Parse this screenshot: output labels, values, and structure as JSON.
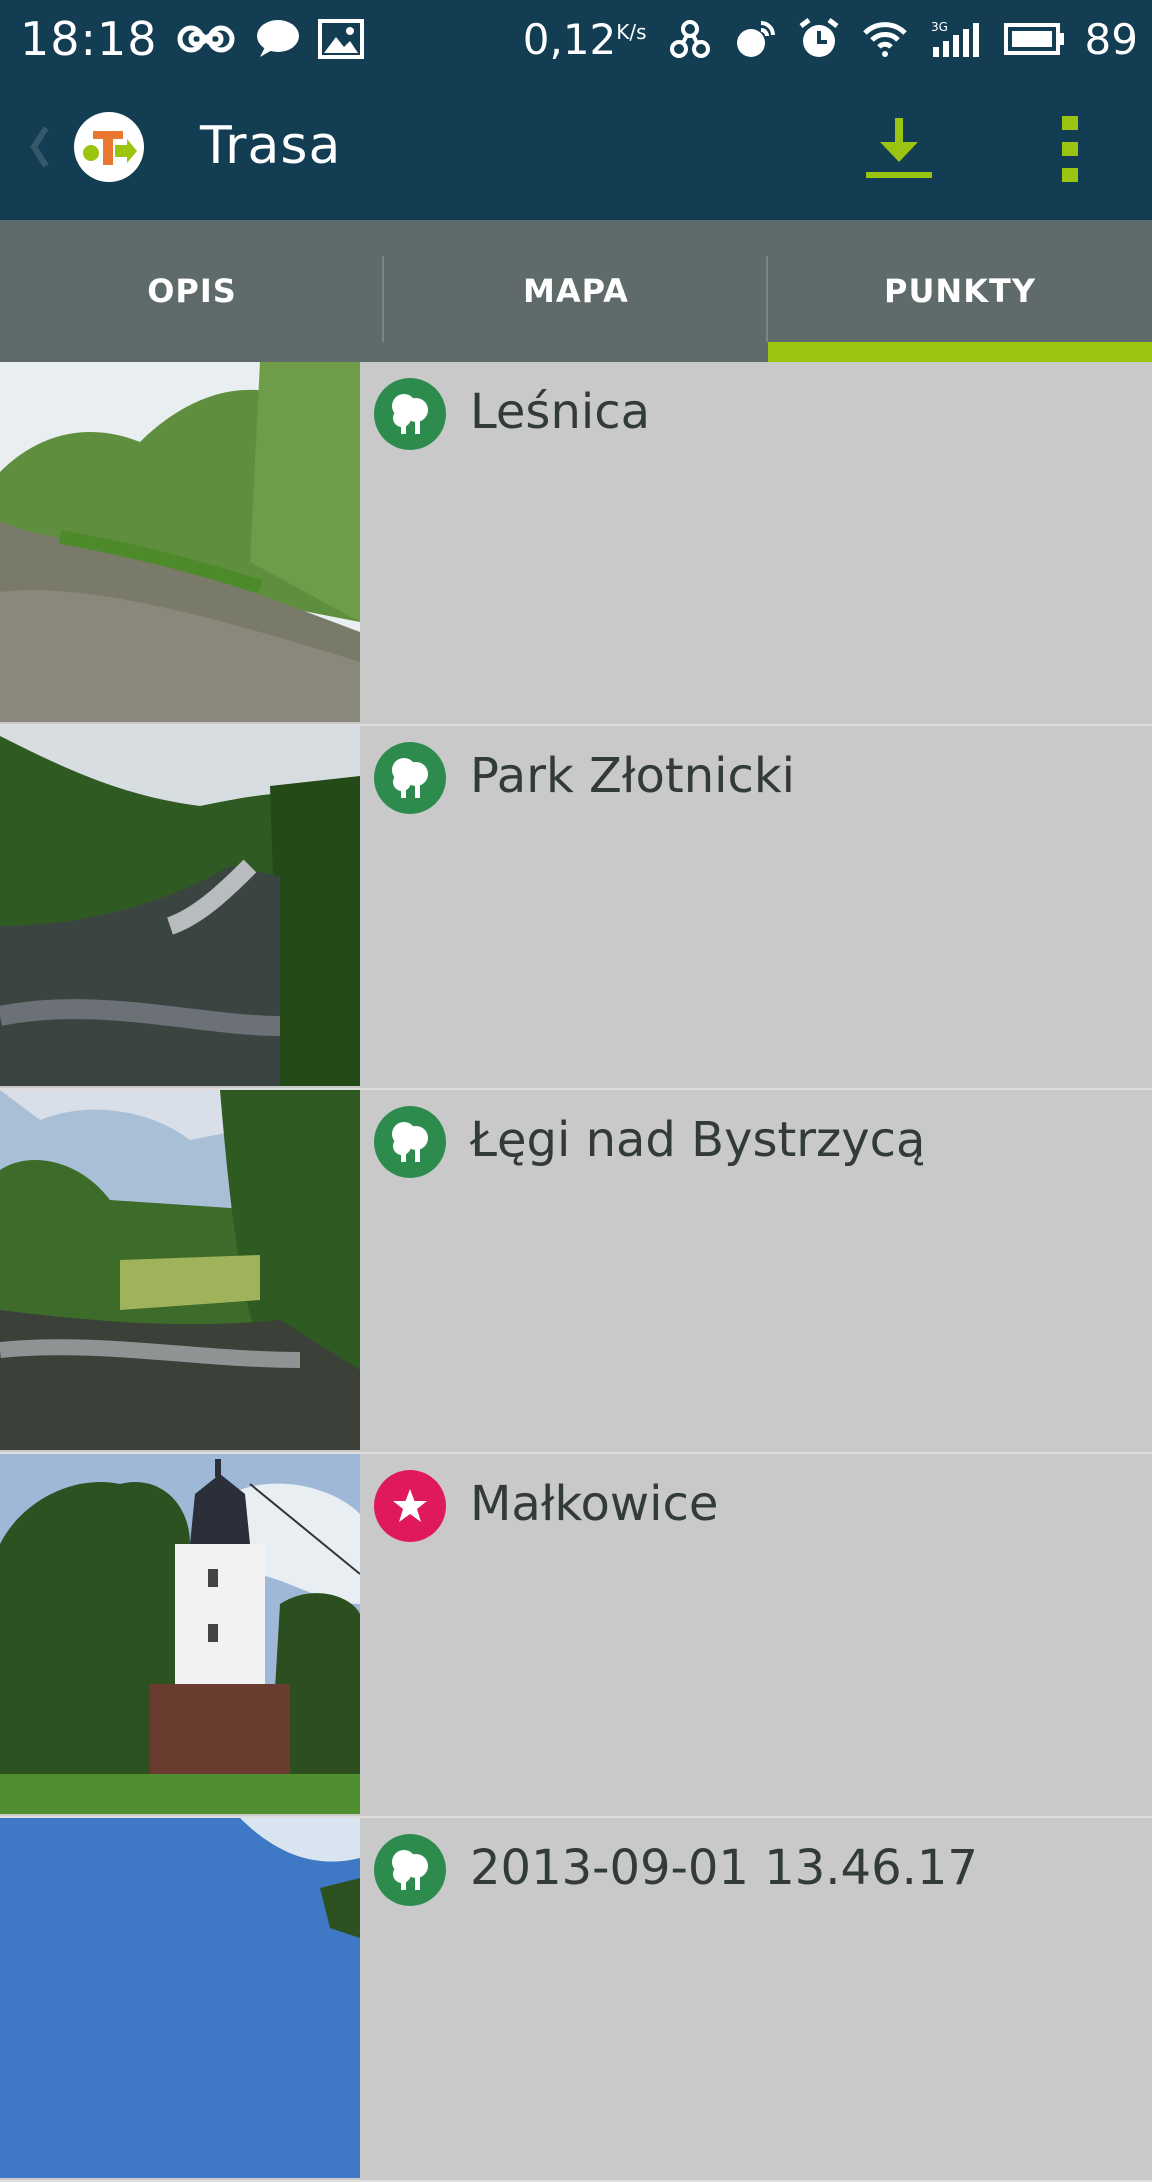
{
  "status_bar": {
    "time": "18:18",
    "net_speed": "0,12",
    "net_speed_unit": "K/s",
    "battery": "89",
    "icons": [
      "infinity-icon",
      "chat-icon",
      "image-icon",
      "network-icon",
      "gps-icon",
      "alarm-icon",
      "wifi-icon",
      "signal-3g-icon",
      "battery-icon"
    ]
  },
  "app_bar": {
    "title": "Trasa",
    "actions": [
      "download-icon",
      "overflow-menu-icon"
    ]
  },
  "tabs": [
    {
      "label": "OPIS"
    },
    {
      "label": "MAPA"
    },
    {
      "label": "PUNKTY"
    }
  ],
  "active_tab": "PUNKTY",
  "colors": {
    "status_bar_bg": "#133d52",
    "tab_bar_bg": "#5f6a6a",
    "accent": "#9bc410",
    "nature_icon": "#2e8b4e",
    "monument_icon": "#e0195c",
    "list_bg": "#c9c9c9"
  },
  "points": [
    {
      "name": "Leśnica",
      "category_icon": "tree-icon"
    },
    {
      "name": "Park Złotnicki",
      "category_icon": "tree-icon"
    },
    {
      "name": "Łęgi nad Bystrzycą",
      "category_icon": "tree-icon"
    },
    {
      "name": "Małkowice",
      "category_icon": "star-icon"
    },
    {
      "name": "2013-09-01 13.46.17",
      "category_icon": "tree-icon"
    }
  ]
}
